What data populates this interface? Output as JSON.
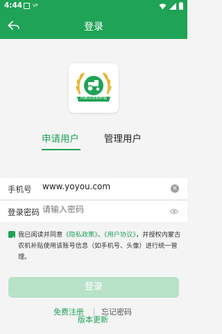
{
  "status_bar": {
    "time": "4:44",
    "notification_text": "VP"
  },
  "app_bar": {
    "title": "登录"
  },
  "logo": {
    "text": "内蒙古农机补贴"
  },
  "tabs": [
    {
      "label": "申请用户",
      "active": true
    },
    {
      "label": "管理用户",
      "active": false
    }
  ],
  "form": {
    "phone_label": "手机号",
    "phone_value": "www.yoyou.com",
    "password_label": "登录密码",
    "password_placeholder": "请输入密码"
  },
  "agreement": {
    "checked": true,
    "prefix": "我已阅读并同意",
    "privacy_link": "《隐私政策》",
    "separator": "、",
    "terms_link": "《用户协议》",
    "suffix": "，并授权内蒙古农机补贴使用该账号信息（如手机号、头像）进行统一管理。"
  },
  "buttons": {
    "login": "登录",
    "register": "免费注册",
    "forgot": "忘记密码",
    "update": "版本更新"
  },
  "colors": {
    "primary": "#1fa356",
    "login_disabled": "#b8e2c8",
    "background": "#f4f4f4"
  }
}
